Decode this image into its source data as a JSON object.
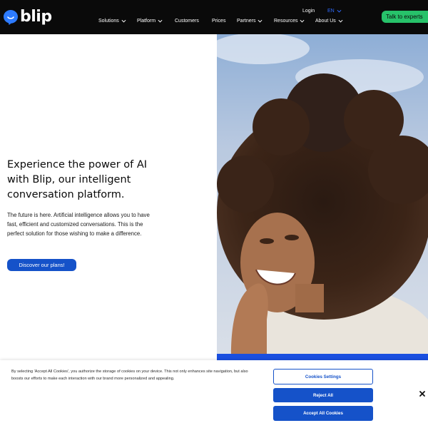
{
  "brand": {
    "name": "blip",
    "accent": "#1552c9",
    "cta_green": "#27c26a",
    "header_bg": "#0a0a0a"
  },
  "nav": {
    "items": [
      {
        "label": "Solutions",
        "dropdown": true
      },
      {
        "label": "Platform",
        "dropdown": true
      },
      {
        "label": "Customers",
        "dropdown": false
      },
      {
        "label": "Prices",
        "dropdown": false
      },
      {
        "label": "Partners",
        "dropdown": true
      },
      {
        "label": "Resources",
        "dropdown": true
      },
      {
        "label": "About Us",
        "dropdown": true
      }
    ],
    "login": "Login",
    "language": "EN",
    "talk_button": "Talk to experts"
  },
  "hero": {
    "title": "Experience the power of AI with Blip, our intelligent conversation platform.",
    "description": "The future is here. Artificial intelligence allows you to have fast, efficient and customized conversations. This is the perfect solution for those wishing to make a difference.",
    "cta": "Discover our plans!"
  },
  "cookie_banner": {
    "text": "By selecting 'Accept All Cookies', you authorize the storage of cookies on your device. This not only enhances site navigation, but also boosts our efforts to make each interaction with our brand more personalized and appealing.",
    "settings_button": "Cookies Settings",
    "reject_button": "Reject All",
    "accept_button": "Accept All Cookies",
    "close_icon": "close-icon"
  }
}
